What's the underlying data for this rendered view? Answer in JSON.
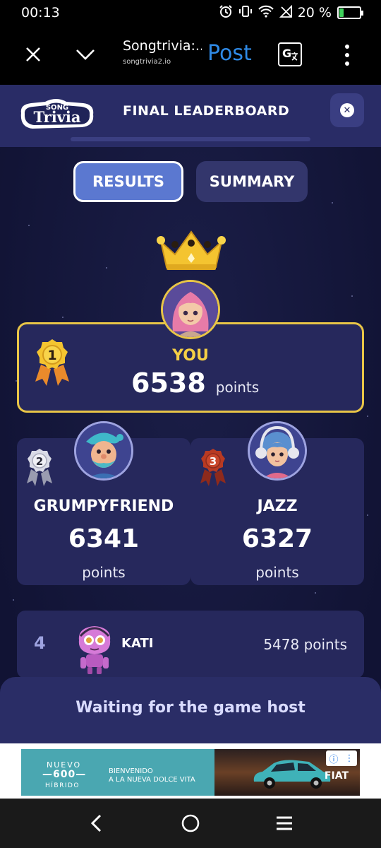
{
  "status_bar": {
    "time": "00:13",
    "battery_percent": "20 %",
    "battery_level": 0.2,
    "icons": [
      "alarm-icon",
      "vibrate-icon",
      "wifi-icon",
      "no-signal-icon",
      "battery-icon"
    ]
  },
  "browser": {
    "title": "Songtrivia:...",
    "url": "songtrivia2.io",
    "action_label": "Post",
    "icons": [
      "close-icon",
      "chevron-down-icon",
      "translate-icon",
      "more-vert-icon"
    ]
  },
  "header": {
    "logo_top": "SONG",
    "logo_bottom": "Trivia",
    "title": "FINAL LEADERBOARD"
  },
  "tabs": [
    {
      "label": "RESULTS",
      "active": true
    },
    {
      "label": "SUMMARY",
      "active": false
    }
  ],
  "winner": {
    "rank": "1",
    "name": "YOU",
    "score": "6538",
    "points_label": "points"
  },
  "runners_up": [
    {
      "rank": "2",
      "name": "GRUMPYFRIEND",
      "score": "6341",
      "points_label": "points"
    },
    {
      "rank": "3",
      "name": "JAZZ",
      "score": "6327",
      "points_label": "points"
    }
  ],
  "ranks": [
    {
      "rank": "4",
      "name": "KATI",
      "score": "5478 points"
    }
  ],
  "waiting": {
    "text": "Waiting for the game host"
  },
  "ad": {
    "nuevo": "NUEVO",
    "model": "600",
    "hybrid": "HÍBRIDO",
    "tagline_1": "BIENVENIDO",
    "tagline_2": "A LA NUEVA DOLCE VITA",
    "brand": "FIAT"
  },
  "colors": {
    "background": "#14163a",
    "card": "#26285c",
    "gold": "#e8c547",
    "accent": "#5b78d0"
  }
}
